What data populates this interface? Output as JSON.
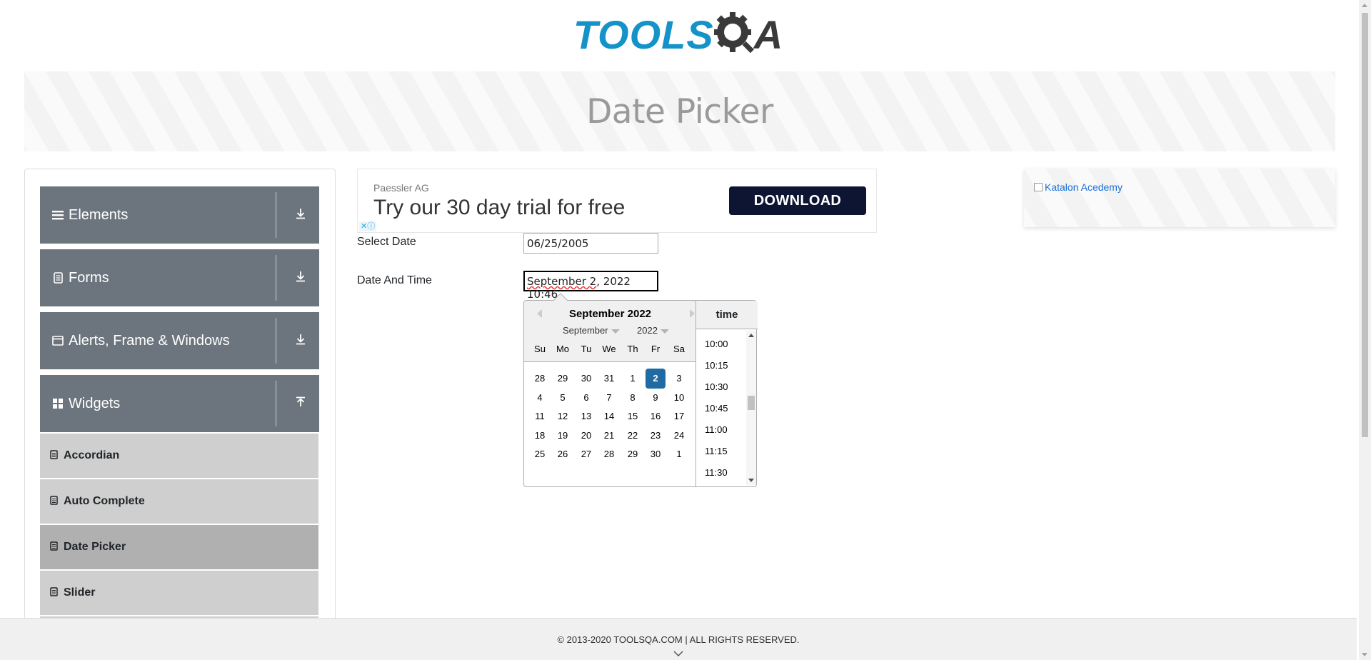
{
  "header": {
    "logo_part1": "TOOLS",
    "logo_part2": "Q",
    "logo_part3": "A",
    "page_title": "Date Picker"
  },
  "sidebar": {
    "groups": [
      {
        "label": "Elements",
        "icon": "hamburger-icon",
        "expanded": false
      },
      {
        "label": "Forms",
        "icon": "document-icon",
        "expanded": false
      },
      {
        "label": "Alerts, Frame & Windows",
        "icon": "window-icon",
        "expanded": false
      },
      {
        "label": "Widgets",
        "icon": "grid-icon",
        "expanded": true
      }
    ],
    "items": [
      {
        "label": "Accordian",
        "active": false
      },
      {
        "label": "Auto Complete",
        "active": false
      },
      {
        "label": "Date Picker",
        "active": true
      },
      {
        "label": "Slider",
        "active": false
      }
    ]
  },
  "ad": {
    "advertiser": "Paessler AG",
    "headline": "Try our 30 day trial for free",
    "button": "DOWNLOAD",
    "adchoices": "✕ⓘ"
  },
  "form": {
    "select_date_label": "Select Date",
    "select_date_value": "06/25/2005",
    "datetime_label": "Date And Time",
    "datetime_value_a": "September 2",
    "datetime_value_b": ", 2022 10:46"
  },
  "datepicker": {
    "title": "September 2022",
    "month_select": "September",
    "year_select": "2022",
    "weekdays": [
      "Su",
      "Mo",
      "Tu",
      "We",
      "Th",
      "Fr",
      "Sa"
    ],
    "weeks": [
      [
        "28",
        "29",
        "30",
        "31",
        "1",
        "2",
        "3"
      ],
      [
        "4",
        "5",
        "6",
        "7",
        "8",
        "9",
        "10"
      ],
      [
        "11",
        "12",
        "13",
        "14",
        "15",
        "16",
        "17"
      ],
      [
        "18",
        "19",
        "20",
        "21",
        "22",
        "23",
        "24"
      ],
      [
        "25",
        "26",
        "27",
        "28",
        "29",
        "30",
        "1"
      ]
    ],
    "selected_day": "2",
    "time_header": "time",
    "times": [
      "10:00",
      "10:15",
      "10:30",
      "10:45",
      "11:00",
      "11:15",
      "11:30"
    ]
  },
  "right_ad": {
    "alt_text": "Katalon Acedemy"
  },
  "footer": {
    "copyright": "© 2013-2020 TOOLSQA.COM | ALL RIGHTS RESERVED."
  },
  "colors": {
    "brand_blue": "#1593c8",
    "sidebar_group": "#6c757d",
    "selected_day": "#216ba5",
    "ad_button": "#0e1533"
  }
}
